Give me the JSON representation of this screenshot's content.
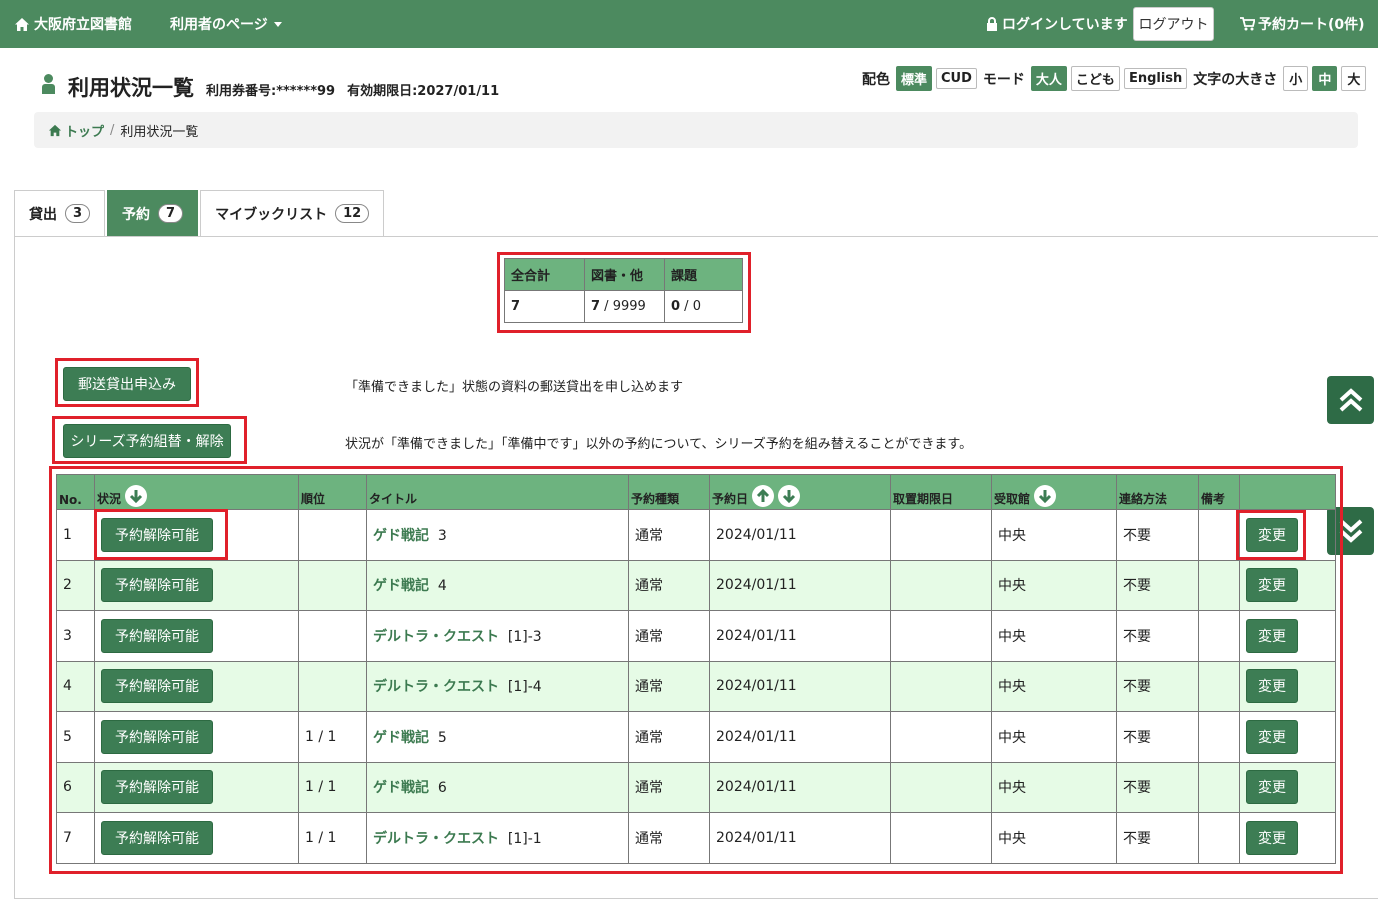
{
  "nav": {
    "brand": "大阪府立図書館",
    "user_menu": "利用者のページ",
    "login_status": "ログインしています",
    "logout": "ログアウト",
    "cart": "予約カート(0件)"
  },
  "header": {
    "title": "利用状況一覧",
    "card_number": "利用券番号:******99",
    "expiry": "有効期限日:2027/01/11"
  },
  "settings": {
    "color_label": "配色",
    "color_options": [
      "標準",
      "CUD"
    ],
    "mode_label": "モード",
    "mode_options": [
      "大人",
      "こども",
      "English"
    ],
    "size_label": "文字の大きさ",
    "size_options": [
      "小",
      "中",
      "大"
    ]
  },
  "breadcrumb": {
    "home": "トップ",
    "sep": "/",
    "current": "利用状況一覧"
  },
  "tabs": [
    {
      "label": "貸出",
      "count": "3"
    },
    {
      "label": "予約",
      "count": "7"
    },
    {
      "label": "マイブックリスト",
      "count": "12"
    }
  ],
  "summary": {
    "headers": [
      "全合計",
      "図書・他",
      "課題"
    ],
    "total": "7",
    "books_bold": "7",
    "books_rest": " / 9999",
    "task_bold": "0",
    "task_rest": " / 0"
  },
  "actions": {
    "mail_button": "郵送貸出申込み",
    "mail_desc": "「準備できました」状態の資料の郵送貸出を申し込めます",
    "series_button": "シリーズ予約組替・解除",
    "series_desc": "状況が「準備できました」「準備中です」以外の予約について、シリーズ予約を組み替えることができます。"
  },
  "table": {
    "headers": {
      "no": "No.",
      "status": "状況",
      "rank": "順位",
      "title": "タイトル",
      "type": "予約種類",
      "date": "予約日",
      "deadline": "取置期限日",
      "library": "受取館",
      "contact": "連絡方法",
      "note": "備考"
    },
    "rows": [
      {
        "no": "1",
        "status": "予約解除可能",
        "rank": "",
        "title": "ゲド戦記",
        "vol": "3",
        "type": "通常",
        "date": "2024/01/11",
        "deadline": "",
        "library": "中央",
        "contact": "不要",
        "note": "",
        "action": "変更"
      },
      {
        "no": "2",
        "status": "予約解除可能",
        "rank": "",
        "title": "ゲド戦記",
        "vol": "4",
        "type": "通常",
        "date": "2024/01/11",
        "deadline": "",
        "library": "中央",
        "contact": "不要",
        "note": "",
        "action": "変更"
      },
      {
        "no": "3",
        "status": "予約解除可能",
        "rank": "",
        "title": "デルトラ・クエスト",
        "vol": "[1]-3",
        "type": "通常",
        "date": "2024/01/11",
        "deadline": "",
        "library": "中央",
        "contact": "不要",
        "note": "",
        "action": "変更"
      },
      {
        "no": "4",
        "status": "予約解除可能",
        "rank": "",
        "title": "デルトラ・クエスト",
        "vol": "[1]-4",
        "type": "通常",
        "date": "2024/01/11",
        "deadline": "",
        "library": "中央",
        "contact": "不要",
        "note": "",
        "action": "変更"
      },
      {
        "no": "5",
        "status": "予約解除可能",
        "rank": "1 / 1",
        "title": "ゲド戦記",
        "vol": "5",
        "type": "通常",
        "date": "2024/01/11",
        "deadline": "",
        "library": "中央",
        "contact": "不要",
        "note": "",
        "action": "変更"
      },
      {
        "no": "6",
        "status": "予約解除可能",
        "rank": "1 / 1",
        "title": "ゲド戦記",
        "vol": "6",
        "type": "通常",
        "date": "2024/01/11",
        "deadline": "",
        "library": "中央",
        "contact": "不要",
        "note": "",
        "action": "変更"
      },
      {
        "no": "7",
        "status": "予約解除可能",
        "rank": "1 / 1",
        "title": "デルトラ・クエスト",
        "vol": "[1]-1",
        "type": "通常",
        "date": "2024/01/11",
        "deadline": "",
        "library": "中央",
        "contact": "不要",
        "note": "",
        "action": "変更"
      }
    ]
  },
  "colors": {
    "brand_green": "#4c8a5f",
    "header_green": "#6db37f",
    "button_green": "#3d7d54",
    "highlight_red": "#e0202a",
    "alt_row": "#e6fbe6"
  }
}
